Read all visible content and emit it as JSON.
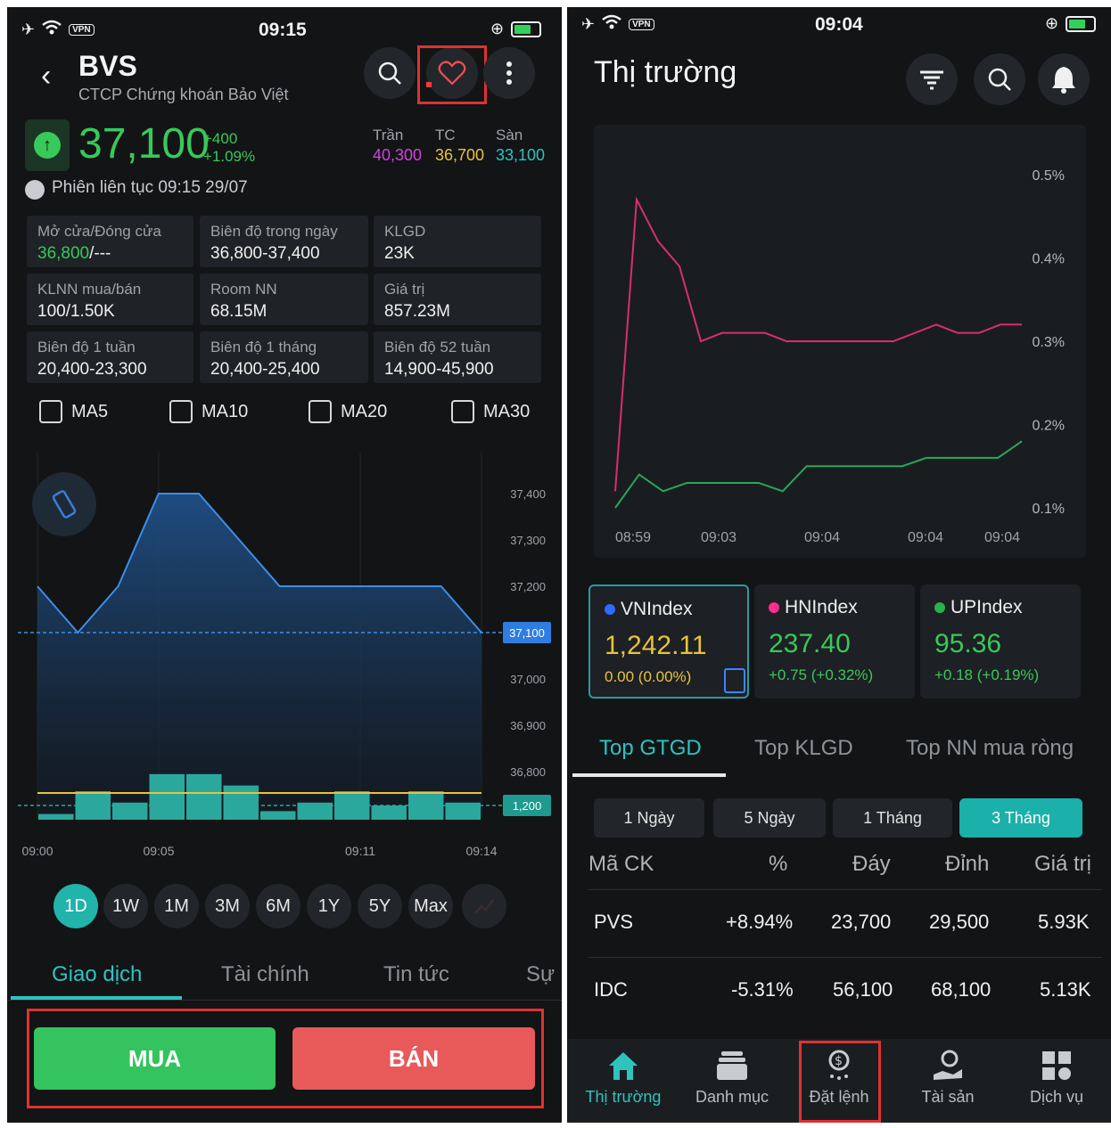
{
  "left": {
    "status": {
      "time": "09:15",
      "vpn": "VPN"
    },
    "header": {
      "ticker": "BVS",
      "company": "CTCP Chứng khoán Bảo Việt"
    },
    "price": {
      "value": "37,100",
      "change": "+400",
      "change_pct": "+1.09%"
    },
    "limits": {
      "ceiling_label": "Trần",
      "ceiling": "40,300",
      "ref_label": "TC",
      "ref": "36,700",
      "floor_label": "Sàn",
      "floor": "33,100"
    },
    "session": "Phiên liên tục 09:15 29/07",
    "stats": [
      {
        "label": "Mở cửa/Đóng cửa",
        "open": "36,800",
        "close": "/---"
      },
      {
        "label": "Biên độ trong ngày",
        "low": "36,800",
        "sep": "-",
        "high": "37,400"
      },
      {
        "label": "KLGD",
        "value": "23K"
      },
      {
        "label": "KLNN mua/bán",
        "value": "100/1.50K"
      },
      {
        "label": "Room NN",
        "value": "68.15M"
      },
      {
        "label": "Giá trị",
        "value": "857.23M"
      },
      {
        "label": "Biên độ 1 tuần",
        "value": "20,400-23,300"
      },
      {
        "label": "Biên độ 1 tháng",
        "value": "20,400-25,400"
      },
      {
        "label": "Biên độ 52 tuần",
        "value": "14,900-45,900"
      }
    ],
    "ma": [
      "MA5",
      "MA10",
      "MA20",
      "MA30"
    ],
    "periods": [
      "1D",
      "1W",
      "1M",
      "3M",
      "6M",
      "1Y",
      "5Y",
      "Max"
    ],
    "tabs": [
      "Giao dịch",
      "Tài chính",
      "Tin tức",
      "Sự"
    ],
    "buy_label": "MUA",
    "sell_label": "BÁN"
  },
  "right": {
    "status": {
      "time": "09:04",
      "vpn": "VPN"
    },
    "title": "Thị trường",
    "indices": [
      {
        "name": "VNIndex",
        "value": "1,242.11",
        "change": "0.00 (0.00%)",
        "dot": "#2f6bff"
      },
      {
        "name": "HNIndex",
        "value": "237.40",
        "change": "+0.75 (+0.32%)",
        "dot": "#ff2e8a"
      },
      {
        "name": "UPIndex",
        "value": "95.36",
        "change": "+0.18 (+0.19%)",
        "dot": "#27b34a"
      }
    ],
    "tabs": [
      "Top GTGD",
      "Top KLGD",
      "Top NN mua ròng"
    ],
    "segments": [
      "1 Ngày",
      "5 Ngày",
      "1 Tháng",
      "3 Tháng"
    ],
    "table": {
      "headers": [
        "Mã CK",
        "%",
        "Đáy",
        "Đỉnh",
        "Giá trị"
      ],
      "rows": [
        {
          "code": "PVS",
          "pct": "+8.94%",
          "low": "23,700",
          "high": "29,500",
          "value": "5.93K"
        },
        {
          "code": "IDC",
          "pct": "-5.31%",
          "low": "56,100",
          "high": "68,100",
          "value": "5.13K"
        }
      ]
    },
    "nav": [
      "Thị trường",
      "Danh mục",
      "Đặt lệnh",
      "Tài sản",
      "Dịch vụ"
    ]
  },
  "chart_data": [
    {
      "type": "area",
      "x_ticks": [
        "09:00",
        "09:05",
        "09:11",
        "09:14"
      ],
      "y_ticks": [
        "37,400",
        "37,300",
        "37,200",
        "37,000",
        "36,900",
        "36,800"
      ],
      "ylim": [
        36700,
        37400
      ],
      "price": [
        37200,
        37100,
        37200,
        37400,
        37400,
        37300,
        37200,
        37200,
        37200,
        37200,
        37200,
        37100
      ],
      "last_price_label": "37,100",
      "volume_label": "1,200",
      "volumes": [
        0.1,
        0.5,
        0.3,
        0.8,
        0.8,
        0.6,
        0.15,
        0.3,
        0.5,
        0.25,
        0.5,
        0.3
      ]
    },
    {
      "type": "line",
      "x_ticks": [
        "08:59",
        "09:03",
        "09:04",
        "09:04",
        "09:04"
      ],
      "y_ticks": [
        "0.5%",
        "0.4%",
        "0.3%",
        "0.2%",
        "0.1%"
      ],
      "series": [
        {
          "color": "#d62f6e",
          "values": [
            0.12,
            0.47,
            0.42,
            0.39,
            0.3,
            0.31,
            0.31,
            0.31,
            0.3,
            0.3,
            0.3,
            0.3,
            0.3,
            0.3,
            0.31,
            0.32,
            0.31,
            0.31,
            0.32,
            0.32
          ]
        },
        {
          "color": "#2aa65a",
          "values": [
            0.1,
            0.14,
            0.12,
            0.13,
            0.13,
            0.13,
            0.13,
            0.12,
            0.15,
            0.15,
            0.15,
            0.15,
            0.15,
            0.16,
            0.16,
            0.16,
            0.16,
            0.18
          ]
        }
      ]
    }
  ]
}
